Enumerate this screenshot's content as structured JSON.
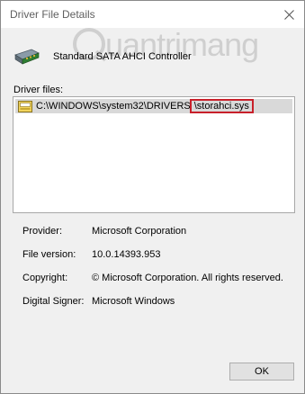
{
  "window": {
    "title": "Driver File Details",
    "close_icon": "close-icon"
  },
  "device": {
    "name": "Standard SATA AHCI Controller",
    "icon": "storage-controller-icon"
  },
  "watermark": {
    "text": "uantrimang"
  },
  "files": {
    "label": "Driver files:",
    "items": [
      {
        "path_prefix": "C:\\WINDOWS\\system32\\DRIVERS",
        "file_name": "\\storahci.sys",
        "icon": "driver-file-icon"
      }
    ],
    "highlight_color": "#c8202a"
  },
  "details": {
    "provider_label": "Provider:",
    "provider_value": "Microsoft Corporation",
    "version_label": "File version:",
    "version_value": "10.0.14393.953",
    "copyright_label": "Copyright:",
    "copyright_value": "© Microsoft Corporation. All rights reserved.",
    "signer_label": "Digital Signer:",
    "signer_value": "Microsoft Windows"
  },
  "buttons": {
    "ok_label": "OK"
  }
}
